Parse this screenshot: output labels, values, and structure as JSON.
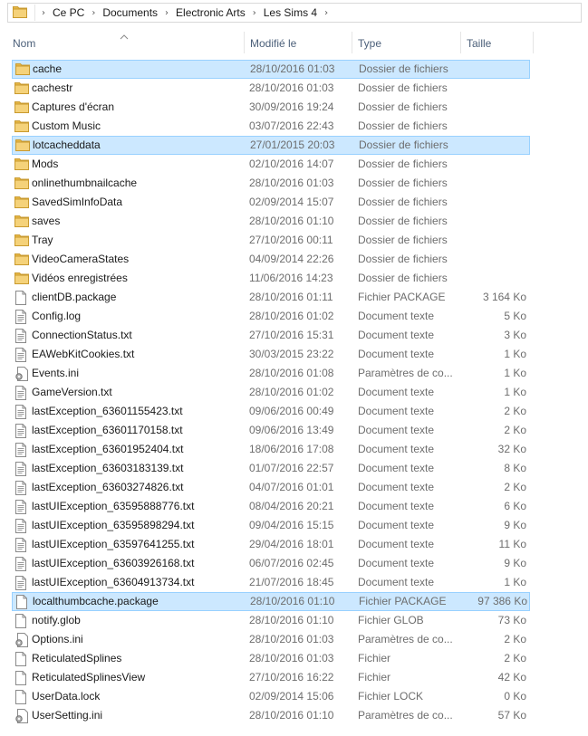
{
  "address": {
    "crumbs": [
      "Ce PC",
      "Documents",
      "Electronic Arts",
      "Les Sims 4"
    ]
  },
  "columns": {
    "name": "Nom",
    "modified": "Modifié le",
    "type": "Type",
    "size": "Taille"
  },
  "files": [
    {
      "name": "cache",
      "date": "28/10/2016 01:03",
      "type": "Dossier de fichiers",
      "size": "",
      "icon": "folder-icon",
      "selected": true
    },
    {
      "name": "cachestr",
      "date": "28/10/2016 01:03",
      "type": "Dossier de fichiers",
      "size": "",
      "icon": "folder-icon",
      "selected": false
    },
    {
      "name": "Captures d'écran",
      "date": "30/09/2016 19:24",
      "type": "Dossier de fichiers",
      "size": "",
      "icon": "folder-icon",
      "selected": false
    },
    {
      "name": "Custom Music",
      "date": "03/07/2016 22:43",
      "type": "Dossier de fichiers",
      "size": "",
      "icon": "folder-icon",
      "selected": false
    },
    {
      "name": "lotcacheddata",
      "date": "27/01/2015 20:03",
      "type": "Dossier de fichiers",
      "size": "",
      "icon": "folder-icon",
      "selected": true
    },
    {
      "name": "Mods",
      "date": "02/10/2016 14:07",
      "type": "Dossier de fichiers",
      "size": "",
      "icon": "folder-icon",
      "selected": false
    },
    {
      "name": "onlinethumbnailcache",
      "date": "28/10/2016 01:03",
      "type": "Dossier de fichiers",
      "size": "",
      "icon": "folder-icon",
      "selected": false
    },
    {
      "name": "SavedSimInfoData",
      "date": "02/09/2014 15:07",
      "type": "Dossier de fichiers",
      "size": "",
      "icon": "folder-icon",
      "selected": false
    },
    {
      "name": "saves",
      "date": "28/10/2016 01:10",
      "type": "Dossier de fichiers",
      "size": "",
      "icon": "folder-icon",
      "selected": false
    },
    {
      "name": "Tray",
      "date": "27/10/2016 00:11",
      "type": "Dossier de fichiers",
      "size": "",
      "icon": "folder-icon",
      "selected": false
    },
    {
      "name": "VideoCameraStates",
      "date": "04/09/2014 22:26",
      "type": "Dossier de fichiers",
      "size": "",
      "icon": "folder-icon",
      "selected": false
    },
    {
      "name": "Vidéos enregistrées",
      "date": "11/06/2016 14:23",
      "type": "Dossier de fichiers",
      "size": "",
      "icon": "folder-icon",
      "selected": false
    },
    {
      "name": "clientDB.package",
      "date": "28/10/2016 01:11",
      "type": "Fichier PACKAGE",
      "size": "3 164 Ko",
      "icon": "file-icon",
      "selected": false
    },
    {
      "name": "Config.log",
      "date": "28/10/2016 01:02",
      "type": "Document texte",
      "size": "5 Ko",
      "icon": "text-file-icon",
      "selected": false
    },
    {
      "name": "ConnectionStatus.txt",
      "date": "27/10/2016 15:31",
      "type": "Document texte",
      "size": "3 Ko",
      "icon": "text-file-icon",
      "selected": false
    },
    {
      "name": "EAWebKitCookies.txt",
      "date": "30/03/2015 23:22",
      "type": "Document texte",
      "size": "1 Ko",
      "icon": "text-file-icon",
      "selected": false
    },
    {
      "name": "Events.ini",
      "date": "28/10/2016 01:08",
      "type": "Paramètres de co...",
      "size": "1 Ko",
      "icon": "settings-file-icon",
      "selected": false
    },
    {
      "name": "GameVersion.txt",
      "date": "28/10/2016 01:02",
      "type": "Document texte",
      "size": "1 Ko",
      "icon": "text-file-icon",
      "selected": false
    },
    {
      "name": "lastException_63601155423.txt",
      "date": "09/06/2016 00:49",
      "type": "Document texte",
      "size": "2 Ko",
      "icon": "text-file-icon",
      "selected": false
    },
    {
      "name": "lastException_63601170158.txt",
      "date": "09/06/2016 13:49",
      "type": "Document texte",
      "size": "2 Ko",
      "icon": "text-file-icon",
      "selected": false
    },
    {
      "name": "lastException_63601952404.txt",
      "date": "18/06/2016 17:08",
      "type": "Document texte",
      "size": "32 Ko",
      "icon": "text-file-icon",
      "selected": false
    },
    {
      "name": "lastException_63603183139.txt",
      "date": "01/07/2016 22:57",
      "type": "Document texte",
      "size": "8 Ko",
      "icon": "text-file-icon",
      "selected": false
    },
    {
      "name": "lastException_63603274826.txt",
      "date": "04/07/2016 01:01",
      "type": "Document texte",
      "size": "2 Ko",
      "icon": "text-file-icon",
      "selected": false
    },
    {
      "name": "lastUIException_63595888776.txt",
      "date": "08/04/2016 20:21",
      "type": "Document texte",
      "size": "6 Ko",
      "icon": "text-file-icon",
      "selected": false
    },
    {
      "name": "lastUIException_63595898294.txt",
      "date": "09/04/2016 15:15",
      "type": "Document texte",
      "size": "9 Ko",
      "icon": "text-file-icon",
      "selected": false
    },
    {
      "name": "lastUIException_63597641255.txt",
      "date": "29/04/2016 18:01",
      "type": "Document texte",
      "size": "11 Ko",
      "icon": "text-file-icon",
      "selected": false
    },
    {
      "name": "lastUIException_63603926168.txt",
      "date": "06/07/2016 02:45",
      "type": "Document texte",
      "size": "9 Ko",
      "icon": "text-file-icon",
      "selected": false
    },
    {
      "name": "lastUIException_63604913734.txt",
      "date": "21/07/2016 18:45",
      "type": "Document texte",
      "size": "1 Ko",
      "icon": "text-file-icon",
      "selected": false
    },
    {
      "name": "localthumbcache.package",
      "date": "28/10/2016 01:10",
      "type": "Fichier PACKAGE",
      "size": "97 386 Ko",
      "icon": "file-icon",
      "selected": true
    },
    {
      "name": "notify.glob",
      "date": "28/10/2016 01:10",
      "type": "Fichier GLOB",
      "size": "73 Ko",
      "icon": "file-icon",
      "selected": false
    },
    {
      "name": "Options.ini",
      "date": "28/10/2016 01:03",
      "type": "Paramètres de co...",
      "size": "2 Ko",
      "icon": "settings-file-icon",
      "selected": false
    },
    {
      "name": "ReticulatedSplines",
      "date": "28/10/2016 01:03",
      "type": "Fichier",
      "size": "2 Ko",
      "icon": "file-icon",
      "selected": false
    },
    {
      "name": "ReticulatedSplinesView",
      "date": "27/10/2016 16:22",
      "type": "Fichier",
      "size": "42 Ko",
      "icon": "file-icon",
      "selected": false
    },
    {
      "name": "UserData.lock",
      "date": "02/09/2014 15:06",
      "type": "Fichier LOCK",
      "size": "0 Ko",
      "icon": "file-icon",
      "selected": false
    },
    {
      "name": "UserSetting.ini",
      "date": "28/10/2016 01:10",
      "type": "Paramètres de co...",
      "size": "57 Ko",
      "icon": "settings-file-icon",
      "selected": false
    }
  ]
}
